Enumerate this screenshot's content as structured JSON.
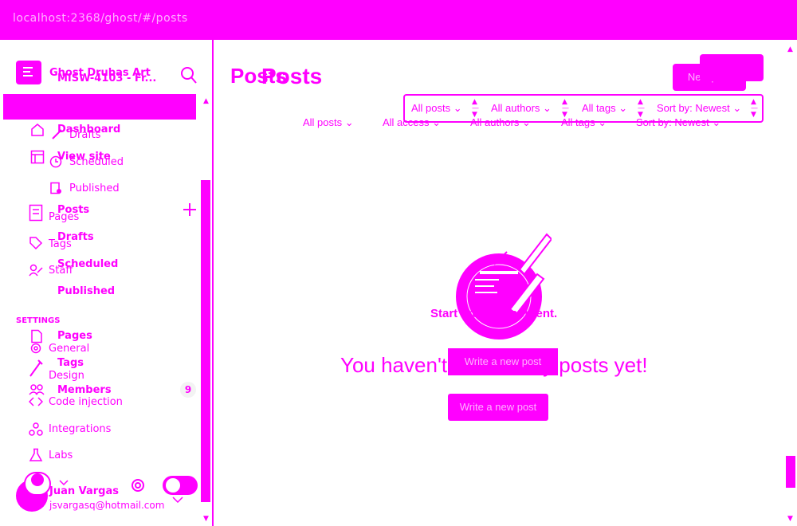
{
  "browser": {
    "address": "localhost:2368/ghost/#/posts"
  },
  "site": {
    "title": "Ghost Drubas Art",
    "title_overlap": "MISW-4103 - Fr..."
  },
  "nav": {
    "dashboard": "Dashboard",
    "view_site": "View site",
    "posts": "Posts",
    "drafts": "Drafts",
    "scheduled": "Scheduled",
    "published": "Published",
    "pages": "Pages",
    "tags": "Tags",
    "staff": "Staff",
    "members": "Members",
    "members_count": "9",
    "sub_drafts": "Drafts",
    "sub_scheduled": "Scheduled",
    "sub_published": "Published"
  },
  "settings": {
    "heading": "SETTINGS",
    "general": "General",
    "design": "Design",
    "code_injection": "Code injection",
    "integrations": "Integrations",
    "labs": "Labs"
  },
  "user": {
    "name": "Juan Vargas",
    "email": "jsvargasq@hotmail.com"
  },
  "main": {
    "title": "Posts",
    "new_post": "New post",
    "empty_heading": "Start creating content.",
    "empty_message": "You haven't written any posts yet!",
    "write_button": "Write a new post"
  },
  "filters_top": {
    "all_posts": "All posts",
    "all_authors": "All authors",
    "all_tags": "All tags",
    "sort": "Sort by: Newest"
  },
  "filters_bottom": {
    "all_posts": "All posts",
    "all_access": "All access",
    "all_authors": "All authors",
    "all_tags": "All tags",
    "sort": "Sort by: Newest"
  },
  "colors": {
    "accent": "#ff00ff",
    "accent_light": "#ffb3ff"
  }
}
